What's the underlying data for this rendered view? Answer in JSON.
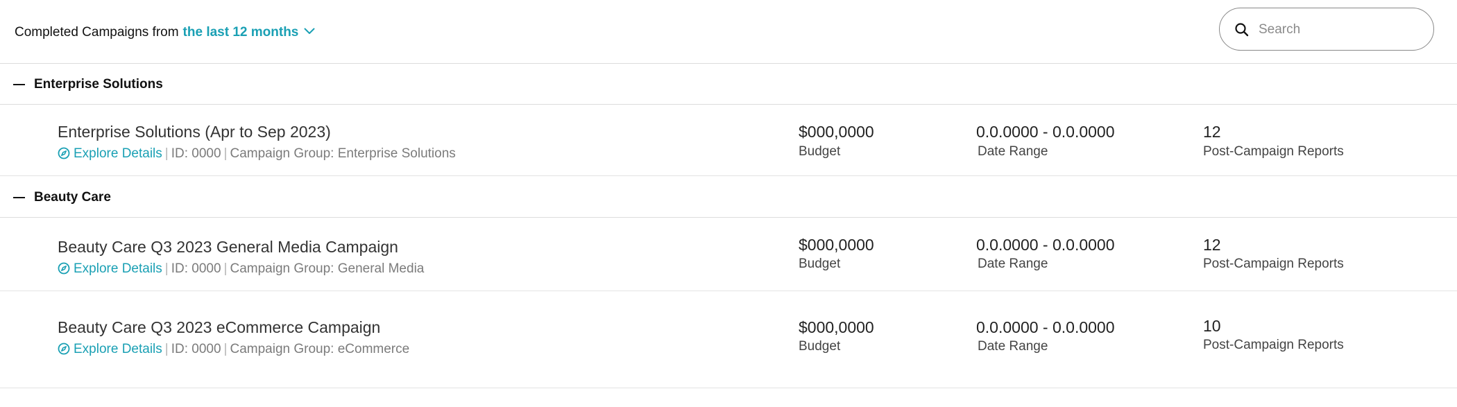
{
  "header": {
    "filter_prefix": "Completed Campaigns from",
    "filter_range": "the last 12 months",
    "filter_icon": "chevron-down-icon",
    "search_placeholder": "Search",
    "search_value": "",
    "search_icon": "search-icon"
  },
  "colors": {
    "accent": "#1aa0b4",
    "divider": "#dcdcdc",
    "muted_text": "#7b7b7b"
  },
  "labels": {
    "budget": "Budget",
    "date_range": "Date Range",
    "reports": "Post-Campaign Reports",
    "explore": "Explore Details",
    "explore_icon": "compass-icon",
    "collapse_icon": "minus-icon"
  },
  "groups": [
    {
      "name": "Enterprise Solutions",
      "campaigns": [
        {
          "title": "Enterprise Solutions (Apr to Sep 2023)",
          "id_text": "ID: 0000",
          "group_text": "Campaign Group: Enterprise Solutions",
          "budget": "$000,0000",
          "date_range": "0.0.0000 - 0.0.0000",
          "reports": "12"
        }
      ]
    },
    {
      "name": "Beauty Care",
      "campaigns": [
        {
          "title": "Beauty Care Q3 2023 General Media Campaign",
          "id_text": "ID: 0000",
          "group_text": "Campaign Group: General Media",
          "budget": "$000,0000",
          "date_range": "0.0.0000 - 0.0.0000",
          "reports": "12"
        },
        {
          "title": "Beauty Care Q3 2023 eCommerce Campaign",
          "id_text": "ID: 0000",
          "group_text": "Campaign Group: eCommerce",
          "budget": "$000,0000",
          "date_range": "0.0.0000 - 0.0.0000",
          "reports": "10"
        }
      ]
    }
  ]
}
